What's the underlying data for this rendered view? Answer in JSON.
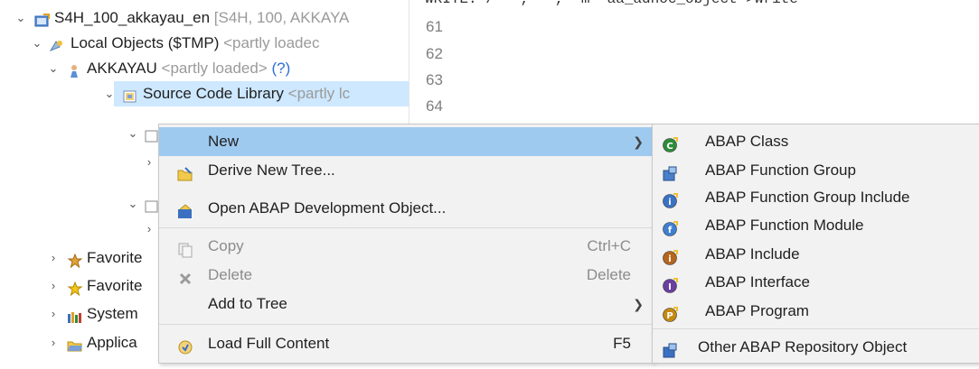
{
  "tree": {
    "project": {
      "name": "S4H_100_akkayau_en",
      "details": "[S4H, 100, AKKAYA"
    },
    "local_objects": {
      "name": "Local Objects ($TMP)",
      "status": "<partly loadec"
    },
    "user": {
      "name": "AKKAYAU",
      "status": "<partly loaded>",
      "help": "(?)"
    },
    "library": {
      "name": "Source Code Library",
      "status": "<partly lc"
    },
    "favorites_1": {
      "name": "Favorite"
    },
    "favorites_2": {
      "name": "Favorite"
    },
    "system": {
      "name": "System"
    },
    "application": {
      "name": "Applica"
    }
  },
  "editor": {
    "line_numbers": [
      "61",
      "62",
      "63",
      "64"
    ],
    "cut_line": "WRITE: / '', '', 'm' aa_adhoc_object->write"
  },
  "context_menu": {
    "items": [
      {
        "label": "New",
        "shortcut": "",
        "icon": "new-icon",
        "submenu": true,
        "disabled": false
      },
      {
        "label": "Derive New Tree...",
        "shortcut": "",
        "icon": "derive-tree-icon",
        "submenu": false,
        "disabled": false
      },
      {
        "label": "Open ABAP Development Object...",
        "shortcut": "",
        "icon": "open-object-icon",
        "submenu": false,
        "disabled": false
      },
      {
        "label": "Copy",
        "shortcut": "Ctrl+C",
        "icon": "copy-icon",
        "submenu": false,
        "disabled": true
      },
      {
        "label": "Delete",
        "shortcut": "Delete",
        "icon": "delete-icon",
        "submenu": false,
        "disabled": true
      },
      {
        "label": "Add to Tree",
        "shortcut": "",
        "icon": "",
        "submenu": true,
        "disabled": false
      },
      {
        "label": "Load Full Content",
        "shortcut": "F5",
        "icon": "load-content-icon",
        "submenu": false,
        "disabled": false
      }
    ]
  },
  "new_submenu": {
    "items": [
      {
        "label": "ABAP Class",
        "icon": "abap-class-icon",
        "color": "#2e8b3a",
        "letter": "C"
      },
      {
        "label": "ABAP Function Group",
        "icon": "abap-function-group-icon",
        "color": "#4a7fc9",
        "letter": ""
      },
      {
        "label": "ABAP Function Group Include",
        "icon": "abap-function-group-include-icon",
        "color": "#3a72c4",
        "letter": "i"
      },
      {
        "label": "ABAP Function Module",
        "icon": "abap-function-module-icon",
        "color": "#3f7fd0",
        "letter": "f"
      },
      {
        "label": "ABAP Include",
        "icon": "abap-include-icon",
        "color": "#b5651d",
        "letter": "i"
      },
      {
        "label": "ABAP Interface",
        "icon": "abap-interface-icon",
        "color": "#6a3fa0",
        "letter": "I"
      },
      {
        "label": "ABAP Program",
        "icon": "abap-program-icon",
        "color": "#c48a10",
        "letter": "P"
      },
      {
        "label": "Other ABAP Repository Object",
        "icon": "other-repository-object-icon",
        "color": "#3b6fc2",
        "letter": ""
      }
    ]
  }
}
